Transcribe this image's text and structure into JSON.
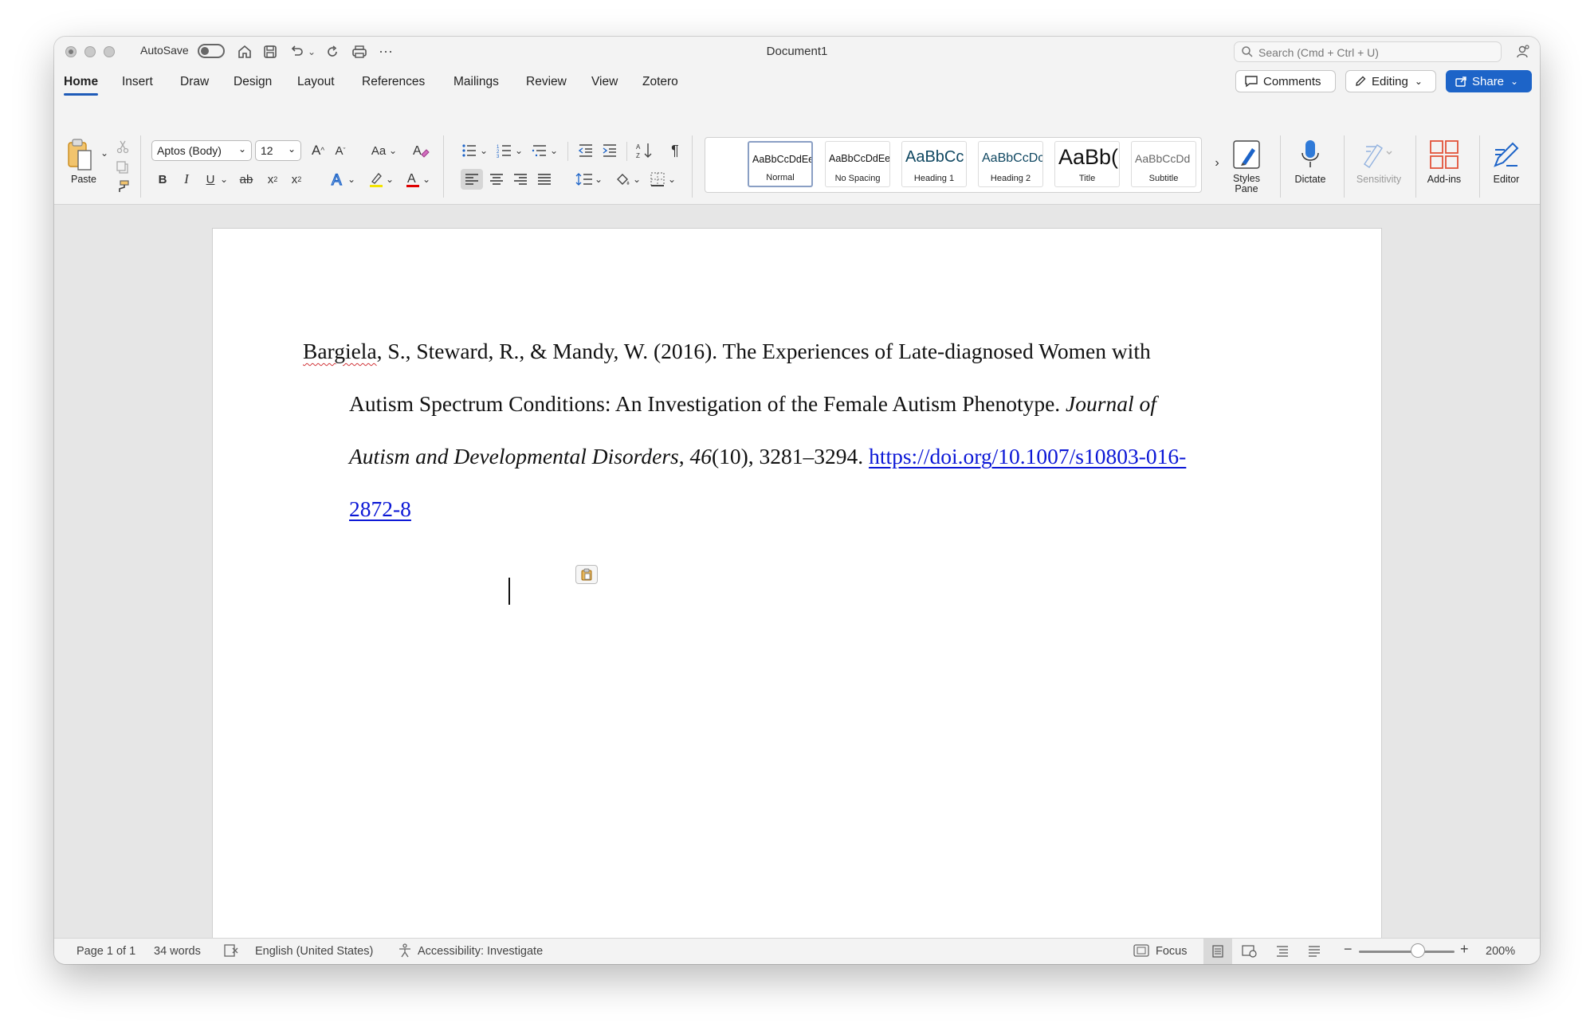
{
  "window": {
    "title": "Document1",
    "autosave_label": "AutoSave",
    "search_placeholder": "Search (Cmd + Ctrl + U)"
  },
  "tabs": [
    "Home",
    "Insert",
    "Draw",
    "Design",
    "Layout",
    "References",
    "Mailings",
    "Review",
    "View",
    "Zotero"
  ],
  "header_buttons": {
    "comments": "Comments",
    "editing": "Editing",
    "share": "Share"
  },
  "ribbon": {
    "paste_label": "Paste",
    "font_name": "Aptos (Body)",
    "font_size": "12",
    "change_case": "Aa",
    "styles": [
      {
        "preview": "AaBbCcDdEe",
        "name": "Normal"
      },
      {
        "preview": "AaBbCcDdEe",
        "name": "No Spacing"
      },
      {
        "preview": "AaBbCc",
        "name": "Heading 1"
      },
      {
        "preview": "AaBbCcDc",
        "name": "Heading 2"
      },
      {
        "preview": "AaBb(",
        "name": "Title"
      },
      {
        "preview": "AaBbCcDd",
        "name": "Subtitle"
      }
    ],
    "styles_pane": "Styles Pane",
    "dictate": "Dictate",
    "sensitivity": "Sensitivity",
    "addins": "Add-ins",
    "editor": "Editor"
  },
  "document": {
    "line1_misspelled": "Bargiela",
    "line1_rest": ", S., Steward, R., & Mandy, W. (2016). The Experiences of Late-diagnosed Women with",
    "line2_plain": "Autism Spectrum Conditions: An Investigation of the Female Autism Phenotype. ",
    "line2_italic": "Journal of",
    "line3_italic": "Autism and Developmental Disorders",
    "line3_sep": ", ",
    "line3_volume": "46",
    "line3_rest": "(10), 3281–3294. ",
    "link_part1": "https://doi.org/10.1007/s10803-016-",
    "link_part2": "2872-8"
  },
  "status": {
    "page": "Page 1 of 1",
    "words": "34 words",
    "language": "English (United States)",
    "accessibility": "Accessibility: Investigate",
    "focus": "Focus",
    "zoom": "200%"
  },
  "colors": {
    "accent": "#1d64c8",
    "link": "#0b17d6",
    "spellcheck": "#d13438"
  }
}
